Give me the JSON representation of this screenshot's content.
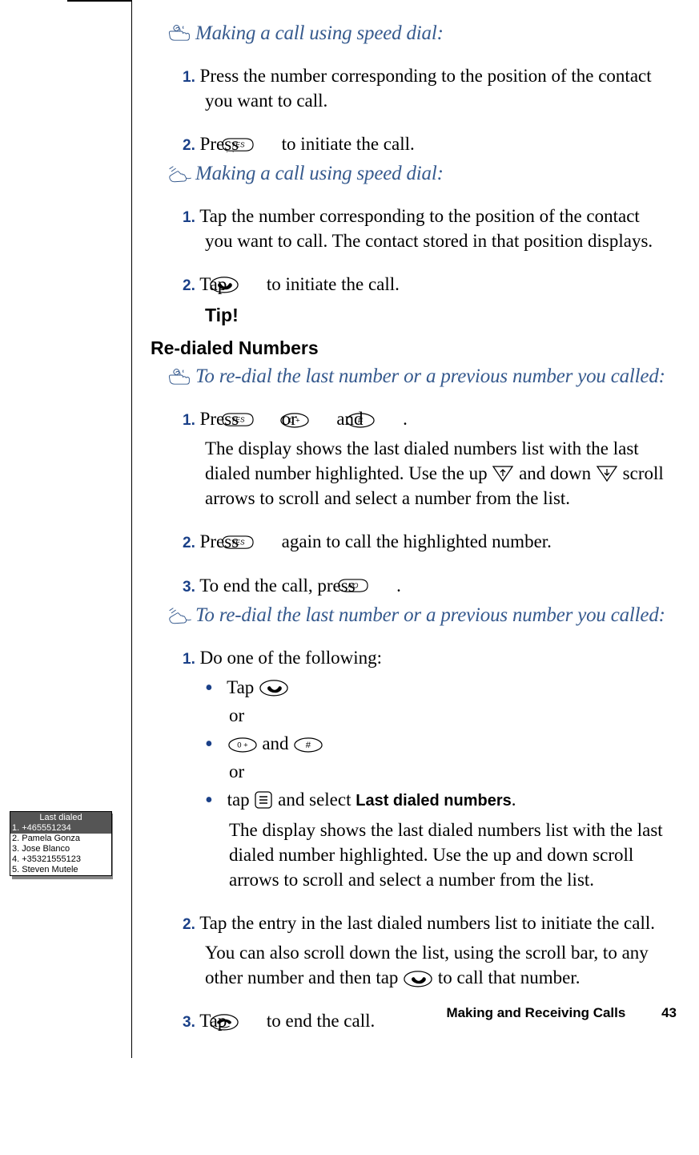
{
  "sections": {
    "speed_dial_1": {
      "title": "Making a call using speed dial:",
      "icon": "keypad-hand-icon",
      "steps": {
        "s1": {
          "num": "1.",
          "text_before": "Press the number corresponding to the position of the contact you want to call."
        },
        "s2": {
          "num": "2.",
          "text_before": "Press ",
          "key": "YES",
          "text_after": " to initiate the call."
        }
      }
    },
    "speed_dial_2": {
      "title": "Making a call using speed dial:",
      "icon": "touch-hand-icon",
      "steps": {
        "s1": {
          "num": "1.",
          "text": "Tap the number corresponding to the position of the contact you want to call. The contact stored in that position displays."
        },
        "s2": {
          "num": "2.",
          "text_before": "Tap ",
          "text_after": " to initiate the call."
        }
      }
    },
    "tip_label": "Tip!",
    "redialed_heading": "Re-dialed Numbers",
    "redial_1": {
      "title": "To re-dial the last number or a previous number you called:",
      "icon": "keypad-hand-icon",
      "steps": {
        "s1": {
          "num": "1.",
          "text1": "Press ",
          "text2": " or ",
          "text3": " and ",
          "text4": " .",
          "continuation_a": "The display shows the last dialed numbers list with the last dialed number highlighted. Use the up ",
          "continuation_b": " and down ",
          "continuation_c": " scroll arrows to scroll and select a number from the list."
        },
        "s2": {
          "num": "2.",
          "text_before": "Press ",
          "text_after": " again to call the highlighted number."
        },
        "s3": {
          "num": "3.",
          "text_before": "To end the call, press ",
          "text_after": "."
        }
      }
    },
    "redial_2": {
      "title": "To re-dial the last number or a previous number you called:",
      "icon": "touch-hand-icon",
      "steps": {
        "s1": {
          "num": "1.",
          "text": "Do one of the following:",
          "bullets": {
            "b1": {
              "text": "Tap "
            },
            "or1": "or",
            "b2": {
              "text_mid": " and "
            },
            "or2": "or",
            "b3": {
              "text_before": "tap ",
              "text_mid": " and select ",
              "label": "Last dialed numbers",
              "text_after": "."
            }
          },
          "continuation": "The display shows the last dialed numbers list with the last dialed number highlighted. Use the up and down scroll arrows to scroll and select a number from the list."
        },
        "s2": {
          "num": "2.",
          "text": "Tap the entry in the last dialed numbers list to initiate the call.",
          "continuation_a": "You can also scroll down the list, using the scroll bar, to any other number and then tap ",
          "continuation_b": " to call that number."
        },
        "s3": {
          "num": "3.",
          "text_before": "Tap ",
          "text_after": " to end the call."
        }
      }
    }
  },
  "phone_screen": {
    "header": "Last dialed",
    "rows": [
      "1. +465551234",
      "2. Pamela Gonza",
      "3. Jose Blanco",
      "4. +35321555123",
      "5. Steven Mutele"
    ],
    "highlighted_index": 0
  },
  "key_labels": {
    "yes": "YES",
    "no": "NO",
    "zero": "0 +",
    "hash": "#"
  },
  "footer": {
    "chapter": "Making and Receiving Calls",
    "page": "43"
  }
}
